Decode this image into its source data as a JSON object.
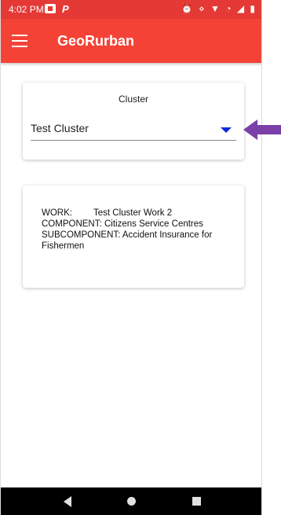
{
  "status_bar": {
    "time": "4:02 PM",
    "p_letter": "P",
    "icons": "⏰ ⋄ ▼ ◔ ◢ ▮"
  },
  "app_bar": {
    "title": "GeoRurban"
  },
  "cluster_card": {
    "label": "Cluster",
    "selected": "Test Cluster"
  },
  "info_card": {
    "work_key": "WORK:",
    "work_value": "Test Cluster Work 2",
    "component_key": "COMPONENT:",
    "component_value": "Citizens Service Centres",
    "subcomponent_key": "SUBCOMPONENT:",
    "subcomponent_value": "Accident Insurance for Fishermen"
  },
  "colors": {
    "statusbar": "#e53935",
    "appbar": "#f44336",
    "dropdown_arrow": "#0d2bd9",
    "pointer_arrow": "#7b3fa8"
  }
}
